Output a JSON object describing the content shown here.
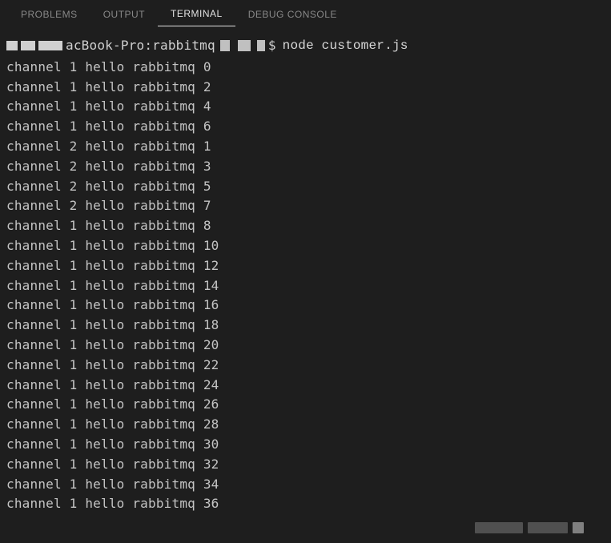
{
  "tabs": {
    "problems": "PROBLEMS",
    "output": "OUTPUT",
    "terminal": "TERMINAL",
    "debug_console": "DEBUG CONSOLE"
  },
  "prompt": {
    "host": "acBook-Pro:rabbitmq",
    "symbol": "$",
    "command": "node customer.js"
  },
  "output_lines": [
    "channel 1 hello rabbitmq 0",
    "channel 1 hello rabbitmq 2",
    "channel 1 hello rabbitmq 4",
    "channel 1 hello rabbitmq 6",
    "channel 2 hello rabbitmq 1",
    "channel 2 hello rabbitmq 3",
    "channel 2 hello rabbitmq 5",
    "channel 2 hello rabbitmq 7",
    "channel 1 hello rabbitmq 8",
    "channel 1 hello rabbitmq 10",
    "channel 1 hello rabbitmq 12",
    "channel 1 hello rabbitmq 14",
    "channel 1 hello rabbitmq 16",
    "channel 1 hello rabbitmq 18",
    "channel 1 hello rabbitmq 20",
    "channel 1 hello rabbitmq 22",
    "channel 1 hello rabbitmq 24",
    "channel 1 hello rabbitmq 26",
    "channel 1 hello rabbitmq 28",
    "channel 1 hello rabbitmq 30",
    "channel 1 hello rabbitmq 32",
    "channel 1 hello rabbitmq 34",
    "channel 1 hello rabbitmq 36"
  ]
}
